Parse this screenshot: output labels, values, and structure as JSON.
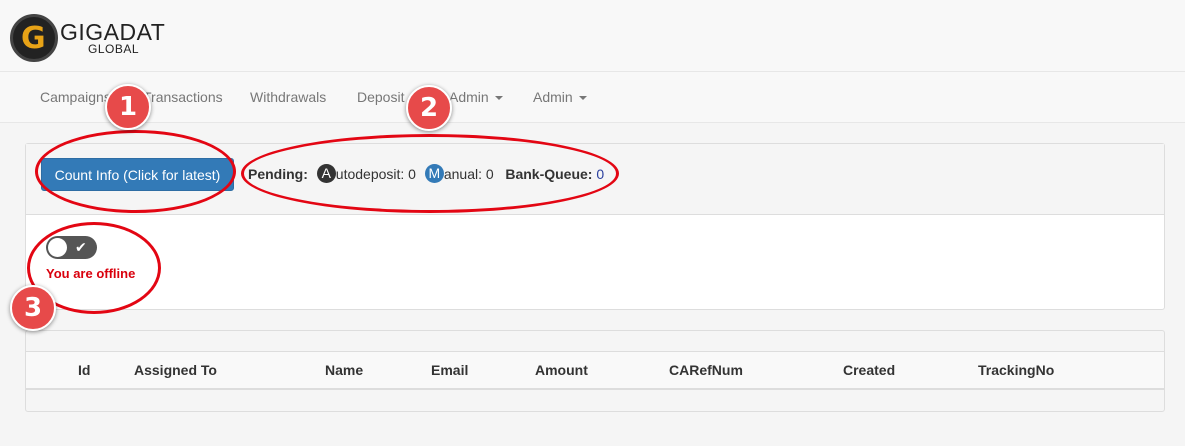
{
  "brand": {
    "name": "GIGADAT",
    "sub": "GLOBAL",
    "logo_letter": "G"
  },
  "nav": {
    "items": [
      {
        "label": "Campaigns"
      },
      {
        "label": "Transactions"
      },
      {
        "label": "Withdrawals"
      },
      {
        "label": "Deposit"
      },
      {
        "label": "Admin"
      },
      {
        "label": "Admin"
      }
    ]
  },
  "panel": {
    "count_button": "Count Info (Click for latest)",
    "pending_label": "Pending:",
    "autodeposit_badge": "A",
    "autodeposit_text": "utodeposit: 0",
    "manual_badge": "M",
    "manual_text": "anual: 0",
    "bank_queue_label": "Bank-Queue:",
    "bank_queue_value": "0",
    "toggle_check": "✔",
    "offline_text": "You are offline"
  },
  "table": {
    "columns": [
      "Id",
      "Assigned To",
      "Name",
      "Email",
      "Amount",
      "CARefNum",
      "Created",
      "TrackingNo"
    ]
  },
  "annotations": {
    "markers": [
      "1",
      "2",
      "3"
    ]
  },
  "colors": {
    "primary": "#337ab7",
    "offline": "#d9000d",
    "annotation": "#e30613"
  }
}
